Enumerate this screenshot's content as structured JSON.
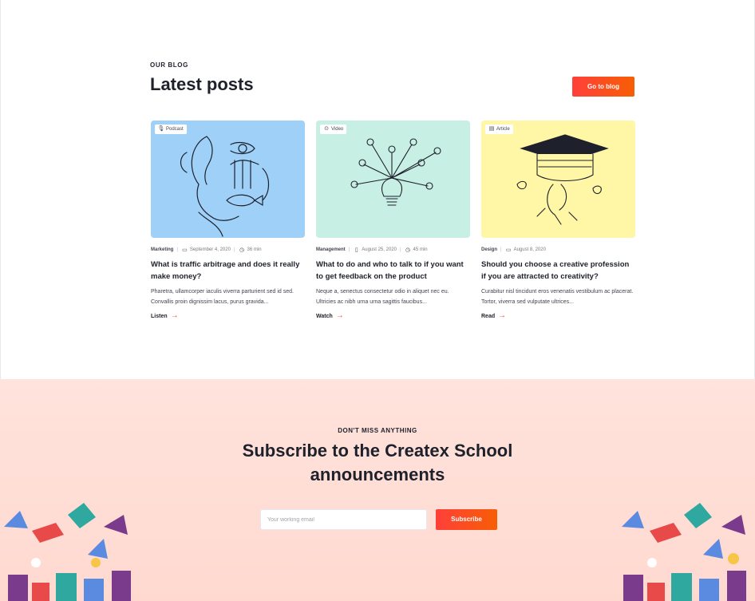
{
  "blog": {
    "eyebrow": "OUR BLOG",
    "title": "Latest posts",
    "go_button": "Go to blog"
  },
  "posts": [
    {
      "type": "Podcast",
      "type_icon": "microphone-icon",
      "category": "Marketing",
      "date": "September 4, 2020",
      "duration": "36 min",
      "title": "What is traffic arbitrage and does it really make money?",
      "excerpt": "Pharetra, ullamcorper iaculis viverra parturient sed id sed. Convallis proin dignissim lacus, purus gravida...",
      "action": "Listen",
      "bg": "#9fd0f8"
    },
    {
      "type": "Video",
      "type_icon": "play-icon",
      "category": "Management",
      "date": "August 25, 2020",
      "duration": "45 min",
      "title": "What to do and who to talk to if you want to get feedback on the product",
      "excerpt": "Neque a, senectus consectetur odio in aliquet nec eu. Ultricies ac nibh urna urna sagittis faucibus...",
      "action": "Watch",
      "bg": "#c7efe4"
    },
    {
      "type": "Article",
      "type_icon": "file-icon",
      "category": "Design",
      "date": "August 8, 2020",
      "title": "Should you choose a creative profession if you are attracted to creativity?",
      "excerpt": "Curabitur nisl tincidunt eros venenatis vestibulum ac placerat. Tortor, viverra sed vulputate ultrices...",
      "action": "Read",
      "bg": "#fff6a6"
    }
  ],
  "subscribe": {
    "eyebrow": "DON'T MISS ANYTHING",
    "title": "Subscribe to the Createx School announcements",
    "placeholder": "Your working email",
    "button": "Subscribe"
  },
  "colors": {
    "accent": "#ff3f3a",
    "dark": "#1e212c"
  }
}
